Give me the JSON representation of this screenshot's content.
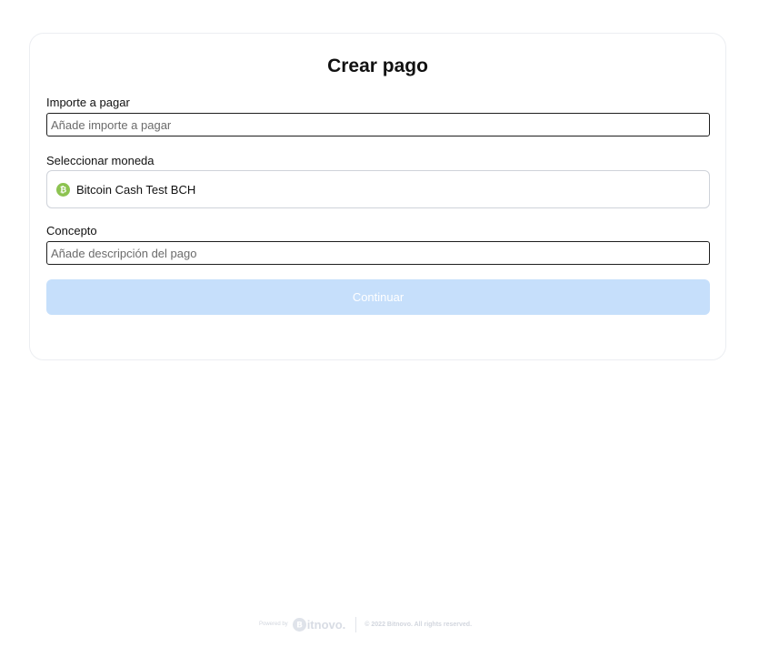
{
  "form": {
    "title": "Crear pago",
    "amount": {
      "label": "Importe a pagar",
      "placeholder": "Añade importe a pagar",
      "value": ""
    },
    "currency": {
      "label": "Seleccionar moneda",
      "selected": "Bitcoin Cash Test BCH",
      "icon": "bitcoin-cash-icon",
      "icon_color": "#8dc351"
    },
    "concept": {
      "label": "Concepto",
      "placeholder": "Añade descripción del pago",
      "value": ""
    },
    "submit_label": "Continuar",
    "submit_color": "#c6dffb"
  },
  "footer": {
    "powered_by": "Powered by",
    "brand": "itnovo.",
    "brand_icon": "bitnovo-logo-icon",
    "copyright": "© 2022 Bitnovo. All rights reserved."
  }
}
